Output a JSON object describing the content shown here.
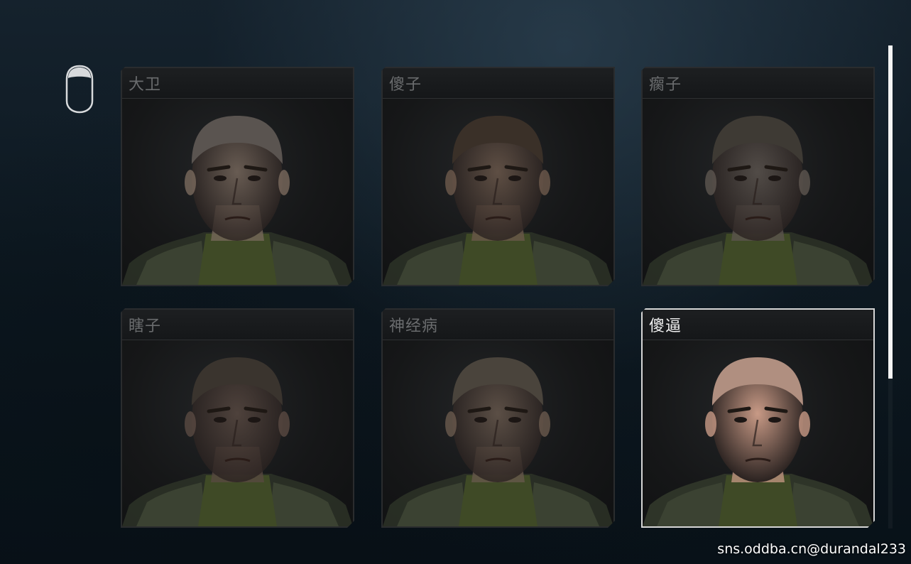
{
  "category_icon": "head-icon",
  "characters": [
    {
      "name": "大卫",
      "selected": false
    },
    {
      "name": "傻子",
      "selected": false
    },
    {
      "name": "瘸子",
      "selected": false
    },
    {
      "name": "瞎子",
      "selected": false
    },
    {
      "name": "神经病",
      "selected": false
    },
    {
      "name": "傻逼",
      "selected": true
    }
  ],
  "scrollbar": {
    "visible_fraction": 0.69,
    "position_fraction": 0.0
  },
  "watermark": "sns.oddba.cn@durandal233"
}
